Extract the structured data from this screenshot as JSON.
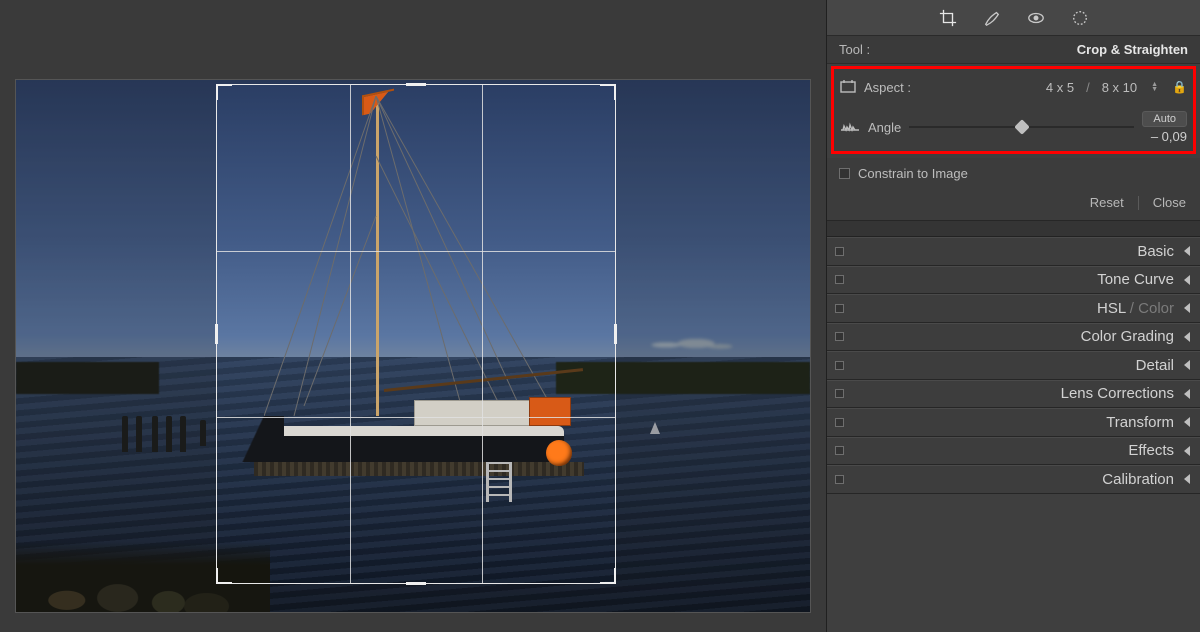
{
  "tool_header": {
    "label": "Tool :",
    "name": "Crop & Straighten"
  },
  "crop": {
    "aspect_label": "Aspect :",
    "aspect_a": "4 x 5",
    "aspect_b": "8 x 10",
    "angle_label": "Angle",
    "auto_label": "Auto",
    "angle_value": "– 0,09",
    "slider_position_pct": 50
  },
  "constrain": {
    "label": "Constrain to Image",
    "checked": false
  },
  "footer": {
    "reset": "Reset",
    "close": "Close"
  },
  "sections": {
    "basic": "Basic",
    "tone_curve": "Tone Curve",
    "hsl": "HSL",
    "hsl_sep": " / ",
    "hsl_color": "Color",
    "color_grading": "Color Grading",
    "detail": "Detail",
    "lens_corr": "Lens Corrections",
    "transform": "Transform",
    "effects": "Effects",
    "calibration": "Calibration"
  }
}
